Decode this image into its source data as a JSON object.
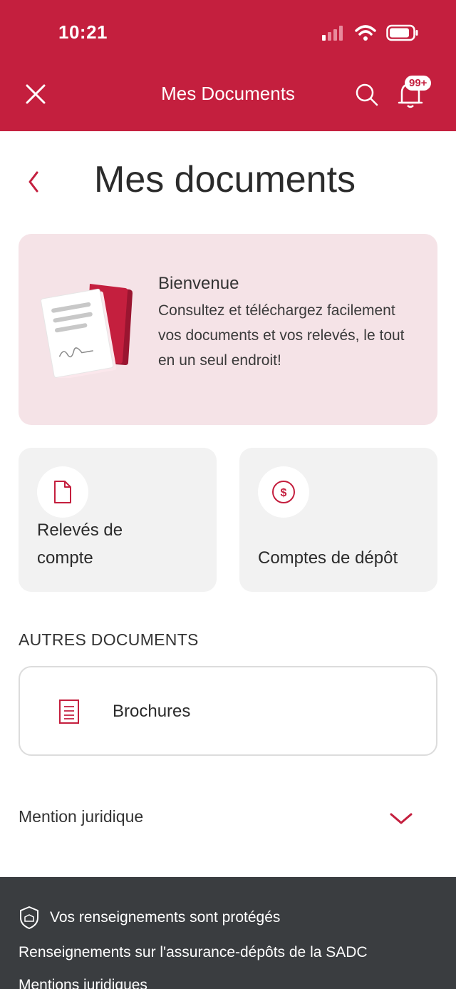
{
  "status_bar": {
    "time": "10:21"
  },
  "nav": {
    "title": "Mes Documents",
    "notification_badge": "99+"
  },
  "page": {
    "title": "Mes documents"
  },
  "welcome": {
    "title": "Bienvenue",
    "text": "Consultez et téléchargez facilement vos documents et vos relevés, le tout en un seul endroit!"
  },
  "quick_links": [
    {
      "label_line1": "Relevés de",
      "label_line2": "compte",
      "icon": "document-icon"
    },
    {
      "label": "Comptes de dépôt",
      "icon": "dollar-circle-icon"
    }
  ],
  "other_documents": {
    "heading": "AUTRES DOCUMENTS",
    "items": [
      {
        "label": "Brochures",
        "icon": "brochure-icon"
      }
    ]
  },
  "legal": {
    "label": "Mention juridique"
  },
  "footer": {
    "protected": "Vos renseignements sont protégés",
    "link_sadc": "Renseignements sur l'assurance-dépôts de la SADC",
    "link_legal": "Mentions juridiques"
  },
  "colors": {
    "brand": "#c41f3e",
    "welcome_bg": "#f5e3e7",
    "card_bg": "#f2f2f2",
    "footer_bg": "#3a3d40"
  }
}
